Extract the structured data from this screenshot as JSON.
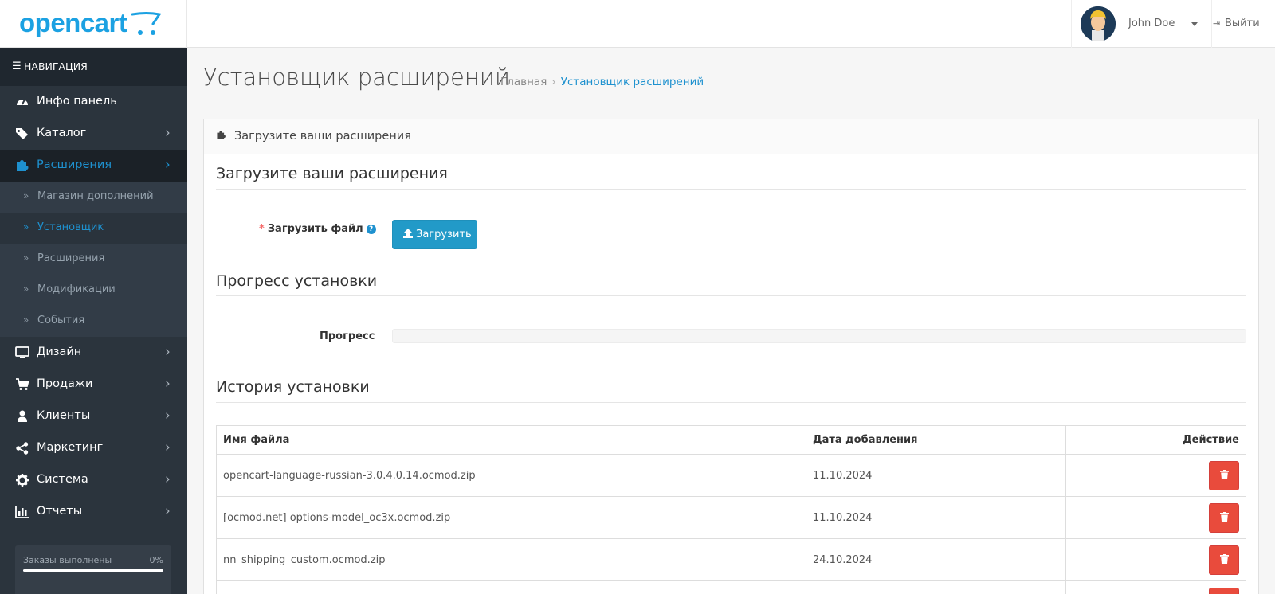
{
  "header": {
    "logo_text": "opencart",
    "user_name": "John Doe",
    "logout_label": "Выйти"
  },
  "sidebar": {
    "nav_title": "НАВИГАЦИЯ",
    "items": [
      {
        "label": "Инфо панель",
        "icon": "dashboard-icon"
      },
      {
        "label": "Каталог",
        "icon": "tags-icon"
      },
      {
        "label": "Расширения",
        "icon": "puzzle-icon"
      },
      {
        "label": "Дизайн",
        "icon": "monitor-icon"
      },
      {
        "label": "Продажи",
        "icon": "shopping-cart-icon"
      },
      {
        "label": "Клиенты",
        "icon": "user-icon"
      },
      {
        "label": "Маркетинг",
        "icon": "share-icon"
      },
      {
        "label": "Система",
        "icon": "gear-icon"
      },
      {
        "label": "Отчеты",
        "icon": "bar-chart-icon"
      }
    ],
    "sub_items": [
      {
        "label": "Магазин дополнений"
      },
      {
        "label": "Установщик"
      },
      {
        "label": "Расширения"
      },
      {
        "label": "Модификации"
      },
      {
        "label": "События"
      }
    ],
    "orders": {
      "label": "Заказы выполнены",
      "percent_text": "0%",
      "percent": 0
    }
  },
  "page": {
    "title": "Установщик расширений",
    "breadcrumb": {
      "home": "Главная",
      "current": "Установщик расширений"
    }
  },
  "panel": {
    "heading": "Загрузите ваши расширения",
    "upload_section_title": "Загрузите ваши расширения",
    "upload_label": "Загрузить файл",
    "upload_required_mark": "*",
    "help_mark": "?",
    "upload_button": "Загрузить",
    "progress_section_title": "Прогресс установки",
    "progress_label": "Прогресс",
    "progress_value": 0,
    "history_section_title": "История установки",
    "history_table": {
      "columns": [
        "Имя файла",
        "Дата добавления",
        "Действие"
      ],
      "rows": [
        {
          "filename": "opencart-language-russian-3.0.4.0.14.ocmod.zip",
          "date": "11.10.2024"
        },
        {
          "filename": "[ocmod.net] options-model_oc3x.ocmod.zip",
          "date": "11.10.2024"
        },
        {
          "filename": "nn_shipping_custom.ocmod.zip",
          "date": "24.10.2024"
        }
      ]
    }
  },
  "colors": {
    "accent": "#1e91cf",
    "sidebar_bg": "#2b343d",
    "danger": "#e94b3c"
  }
}
